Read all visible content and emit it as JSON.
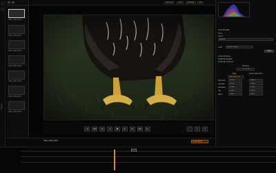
{
  "app": {
    "left_strip_label": "Project"
  },
  "bin": {
    "clips": [
      {
        "name": "A001_C003_0523"
      },
      {
        "name": "A001_C004_0523"
      },
      {
        "name": "A001_C005_0523"
      },
      {
        "name": "A001_C006_0523"
      },
      {
        "name": "A001_C007_0523"
      },
      {
        "name": "A001_C008_0523"
      },
      {
        "name": "A001_C009_0523"
      }
    ]
  },
  "topbar": {
    "btn1": "Normal",
    "btn2": "1/4",
    "btn3": "Full Res",
    "btn4": "Fit"
  },
  "transport": {
    "buttons": [
      "|◀",
      "◀◀",
      "◀|",
      "◀",
      "■",
      "▶",
      "|▶",
      "▶▶",
      "▶|"
    ],
    "right_buttons": [
      "⤢",
      "↻",
      "⇄"
    ]
  },
  "timeline": {
    "clip_label": "A001_C003_0523",
    "timecode": "00:00:00:00"
  },
  "right_panel": {
    "section1": "Look Presets",
    "item1": "None",
    "item2": "Night",
    "item3": "Default",
    "look_label": "Look",
    "look_value": "Clip in Project",
    "apply": "Apply",
    "section2": "Look Controls",
    "section3": "Grading Presets",
    "section4": "Grading Controls",
    "tab": "Primary",
    "mode": "Full Mode",
    "col1": "Base",
    "col2": "Source Resolution",
    "rows": [
      {
        "label": "Exposure",
        "v1": "0.000",
        "v2": "0.000"
      },
      {
        "label": "Contrast",
        "v1": "1.000",
        "v2": "1.000"
      },
      {
        "label": "Saturation",
        "v1": "1.000",
        "v2": "1.000"
      },
      {
        "label": "Tint",
        "v1": "0.000",
        "v2": "0.000"
      },
      {
        "label": "Kelvin",
        "v1": "5600",
        "v2": "5600"
      }
    ],
    "base_select": "Red Gamma"
  }
}
